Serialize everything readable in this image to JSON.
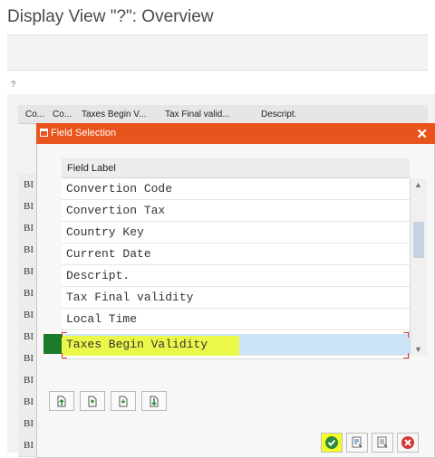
{
  "window": {
    "title": "Display View \"?\": Overview"
  },
  "main": {
    "quick_label": "?",
    "columns": [
      "Co...",
      "Co...",
      "Taxes Begin V...",
      "Tax Final valid...",
      "Descript."
    ],
    "row_labels": [
      "BI",
      "BI",
      "BI",
      "BI",
      "BI",
      "BI",
      "BI",
      "BI",
      "BI",
      "BI",
      "BI",
      "BI",
      "BI"
    ]
  },
  "dialog": {
    "title": "Field Selection",
    "list_header": "Field Label",
    "items": [
      "Convertion Code",
      "Convertion Tax",
      "Country Key",
      "Current Date",
      "Descript.",
      "Tax Final validity",
      "Local Time",
      "Taxes Begin Validity"
    ],
    "selected_item": "Taxes Begin Validity"
  },
  "colors": {
    "dialog_header": "#e9531c",
    "selection": "#cce4f7",
    "highlight": "#eefc2a",
    "confirm": "#2e8b3d",
    "cancel": "#d23838"
  },
  "icons": {
    "dialog": "dialog-window-icon",
    "close": "close-icon",
    "nav": [
      "move-to-top-icon",
      "move-up-icon",
      "move-down-icon",
      "move-to-bottom-icon"
    ],
    "footer": [
      "confirm-icon",
      "field-list-icon",
      "details-icon",
      "cancel-icon"
    ]
  }
}
